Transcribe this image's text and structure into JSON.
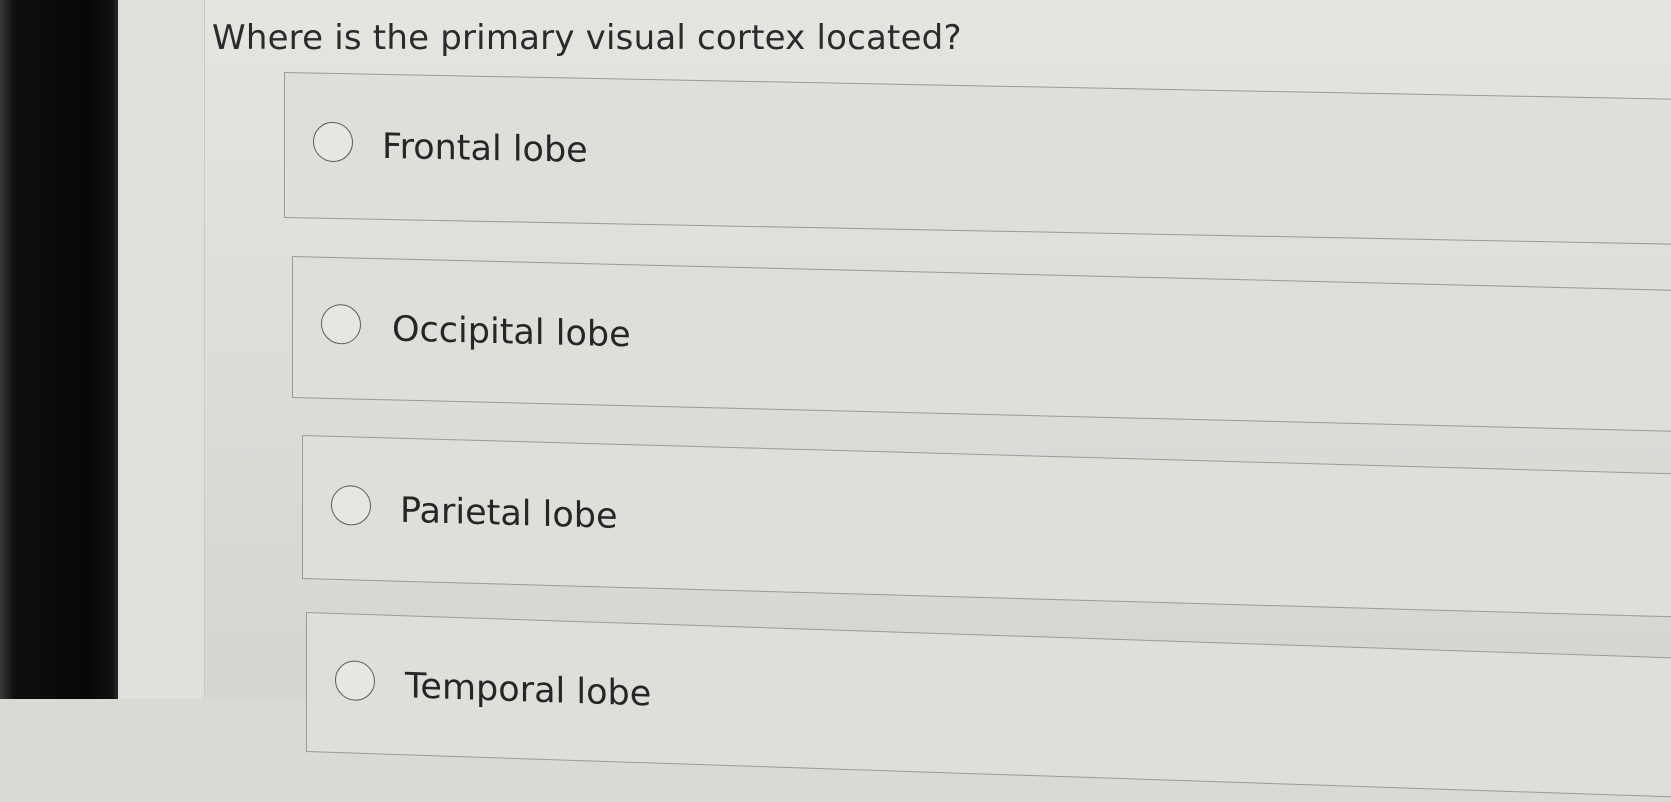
{
  "quiz": {
    "question": "Where is the primary visual cortex located?",
    "options": [
      {
        "label": "Frontal lobe",
        "selected": false
      },
      {
        "label": "Occipital lobe",
        "selected": false
      },
      {
        "label": "Parietal lobe",
        "selected": false
      },
      {
        "label": "Temporal lobe",
        "selected": false
      }
    ]
  }
}
